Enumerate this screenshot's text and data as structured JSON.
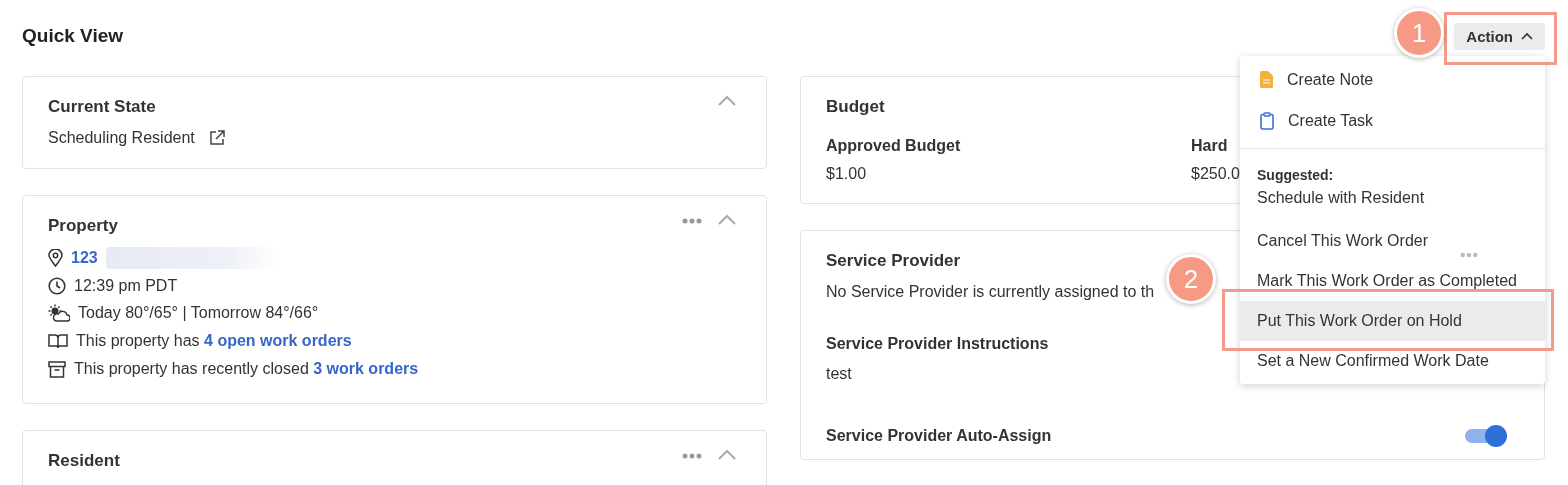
{
  "page": {
    "title": "Quick View"
  },
  "action_button": {
    "label": "Action",
    "expanded": true
  },
  "current_state": {
    "title": "Current State",
    "expanded": true,
    "value": "Scheduling Resident"
  },
  "property": {
    "title": "Property",
    "expanded": true,
    "address": "123",
    "time": "12:39 pm PDT",
    "weather": "Today 80°/65° | Tomorrow 84°/66°",
    "open_orders": {
      "text": "This property has ",
      "link": "4 open work orders"
    },
    "closed_orders": {
      "text": "This property has recently closed ",
      "link": "3 work orders"
    }
  },
  "resident": {
    "title": "Resident",
    "expanded": true
  },
  "budget": {
    "title": "Budget",
    "fields": [
      {
        "label": "Approved Budget",
        "value": "$1.00"
      },
      {
        "label": "Hard",
        "value": "$250.0"
      }
    ]
  },
  "service_provider": {
    "title": "Service Provider",
    "message": "No Service Provider is currently assigned to th",
    "instructions_label": "Service Provider Instructions",
    "instructions": "test",
    "auto_assign": {
      "label": "Service Provider Auto-Assign",
      "on": true
    }
  },
  "action_menu": {
    "items": [
      {
        "kind": "command",
        "label": "Create Note",
        "selected": false
      },
      {
        "kind": "command",
        "label": "Create Task",
        "selected": false
      },
      {
        "kind": "heading",
        "label": "Suggested:"
      },
      {
        "kind": "option",
        "label": "Schedule with Resident",
        "selected": false
      },
      {
        "kind": "option",
        "label": "Cancel This Work Order",
        "selected": false
      },
      {
        "kind": "option",
        "label": "Mark This Work Order as Completed",
        "selected": false
      },
      {
        "kind": "option",
        "label": "Put This Work Order on Hold",
        "selected": true
      },
      {
        "kind": "option",
        "label": "Set a New Confirmed Work Date",
        "selected": false
      }
    ]
  },
  "annotations": [
    {
      "number": "1"
    },
    {
      "number": "2"
    }
  ]
}
